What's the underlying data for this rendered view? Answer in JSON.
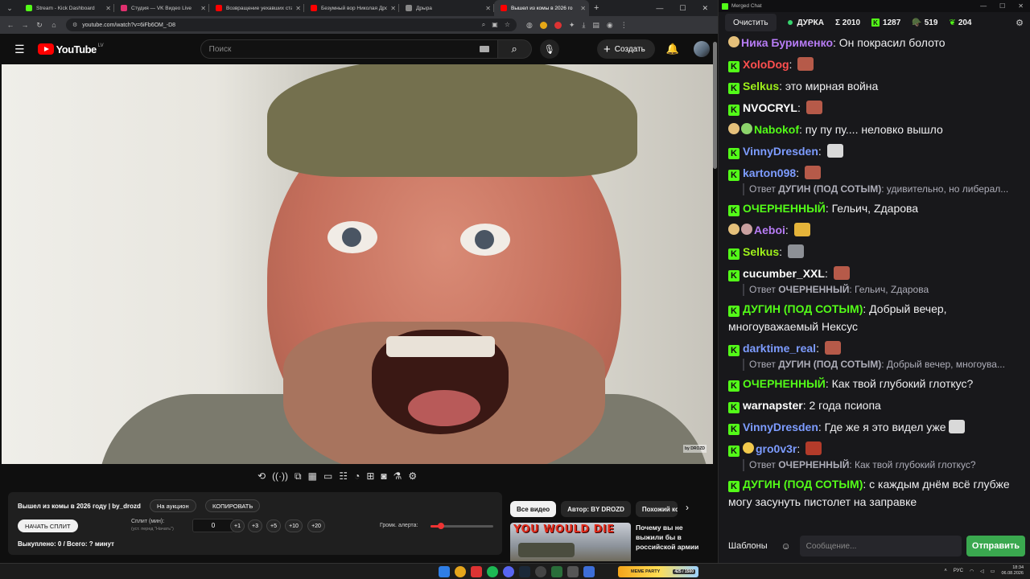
{
  "browser": {
    "tabs": [
      {
        "title": "Stream - Kick Dashboard",
        "color": "#53fc18",
        "active": false
      },
      {
        "title": "Студия — VK Видео Live",
        "color": "#e0306f",
        "active": false
      },
      {
        "title": "Возвращение уехавших стань",
        "color": "#ff0000",
        "active": false
      },
      {
        "title": "Безумный вор Николая Дроз",
        "color": "#ff0000",
        "active": false
      },
      {
        "title": "Дрыра",
        "color": "#888888",
        "active": false
      },
      {
        "title": "Вышел из комы в 2026 го",
        "color": "#ff0000",
        "active": true
      }
    ],
    "url": "youtube.com/watch?v=6iFb6OM_-D8"
  },
  "youtube": {
    "logo_text": "YouTube",
    "country": "LV",
    "search_placeholder": "Поиск",
    "create_label": "Создать",
    "video_watermark": "by DROZD",
    "toolbar_icons": [
      "repeat-icon",
      "broadcast-icon",
      "screen-cast-icon",
      "clapper-icon",
      "pip-icon",
      "subtitles-icon",
      "speed-icon",
      "add-icon",
      "camera-icon",
      "flask-icon",
      "settings-icon"
    ],
    "chips": [
      "Все видео",
      "Автор: BY DROZD",
      "Похожий ко"
    ],
    "related": {
      "thumb_text": "YOU WOULD DIE",
      "title": "Почему вы не выжили бы в российской армии"
    }
  },
  "auction": {
    "title": "Вышел из комы в 2026 году | by_drozd",
    "to_auction": "На аукцион",
    "copy": "КОПИРОВАТЬ",
    "start_split": "НАЧАТЬ СПЛИТ",
    "split_label": "Сплит (мин):",
    "split_hint": "(уст. перед \"Начать\")",
    "split_value": "0",
    "steps": [
      "+1",
      "+3",
      "+5",
      "+10",
      "+20"
    ],
    "volume_label": "Громк. алерта:",
    "volume": 0.17,
    "bought": "Выкуплено: 0 / Всего: ? минут"
  },
  "chat": {
    "window_title": "Merged Chat",
    "clear": "Очистить",
    "channel": "ДУРКА",
    "total": "Σ 2010",
    "kick_count": "1287",
    "twitch_count": "519",
    "vk_count": "204",
    "templates": "Шаблоны",
    "input_placeholder": "Сообщение...",
    "send": "Отправить",
    "colors": {
      "kick": "#53fc18",
      "live": "#37d46e",
      "send": "#3aa84f"
    },
    "messages": [
      {
        "user": "Ника Бурименко",
        "color": "#b77cf5",
        "text": "Он покрасил болото",
        "src": "twitch"
      },
      {
        "user": "XoloDog",
        "color": "#ff4f4f",
        "text": "",
        "emote": "#b65a49",
        "src": "kick"
      },
      {
        "user": "Selkus",
        "color": "#9ef01a",
        "text": "это мирная война",
        "src": "kick"
      },
      {
        "user": "NVOCRYL",
        "color": "#ffffff",
        "text": "",
        "emote": "#b65a49",
        "src": "kick"
      },
      {
        "user": "Nabokof",
        "color": "#53fc18",
        "text": "пу пу пу.... неловко вышло",
        "src": "twitch2"
      },
      {
        "user": "VinnyDresden",
        "color": "#7d9cff",
        "text": "",
        "emote": "#d9d9d9",
        "src": "kick"
      },
      {
        "user": "karton098",
        "color": "#7d9cff",
        "text": "",
        "emote": "#b65a49",
        "src": "kick",
        "reply_prefix": "Ответ",
        "reply_user": "ДУГИН (ПОД СОТЫМ)",
        "reply_text": ": удивительно, но либерал..."
      },
      {
        "user": "ОЧЕРНЕННЫЙ",
        "color": "#53fc18",
        "text": "Гельич, Zдарова",
        "src": "kick"
      },
      {
        "user": "Aeboi",
        "color": "#b77cf5",
        "text": "",
        "emote": "#e5b43a",
        "src": "twitch3"
      },
      {
        "user": "Selkus",
        "color": "#9ef01a",
        "text": "",
        "emote": "#8d9096",
        "src": "kick"
      },
      {
        "user": "cucumber_XXL",
        "color": "#ffffff",
        "text": "",
        "emote": "#b65a49",
        "src": "kick",
        "reply_prefix": "Ответ",
        "reply_user": "ОЧЕРНЕННЫЙ",
        "reply_text": ": Гельич, Zдарова"
      },
      {
        "user": "ДУГИН (ПОД СОТЫМ)",
        "color": "#53fc18",
        "text": "Добрый вечер, многоуважаемый Нексус",
        "src": "kick"
      },
      {
        "user": "darktime_real",
        "color": "#7d9cff",
        "text": "",
        "emote": "#b65a49",
        "src": "kick",
        "reply_prefix": "Ответ",
        "reply_user": "ДУГИН (ПОД СОТЫМ)",
        "reply_text": ": Добрый вечер, многоува..."
      },
      {
        "user": "ОЧЕРНЕННЫЙ",
        "color": "#53fc18",
        "text": "Как твой глубокий глоткус?",
        "src": "kick"
      },
      {
        "user": "warnapster",
        "color": "#ffffff",
        "text": "2 года псиопа",
        "src": "kick"
      },
      {
        "user": "VinnyDresden",
        "color": "#7d9cff",
        "text": "Где же я это видел уже",
        "emote_after": "#d9d9d9",
        "src": "kick"
      },
      {
        "user": "gro0v3r",
        "color": "#7d9cff",
        "text": "",
        "emote": "#b33b2a",
        "src": "kick4",
        "reply_prefix": "Ответ",
        "reply_user": "ОЧЕРНЕННЫЙ",
        "reply_text": ": Как твой глубокий глоткус?"
      },
      {
        "user": "ДУГИН (ПОД СОТЫМ)",
        "color": "#53fc18",
        "text": "с каждым днём всё глубже могу засунуть пистолет на заправке",
        "src": "kick"
      }
    ]
  },
  "taskbar": {
    "widget_text": "MEME PARTY",
    "widget_count": "425 / 1500",
    "lang": "РУС",
    "time": "18:34",
    "date": "06.08.2026"
  }
}
